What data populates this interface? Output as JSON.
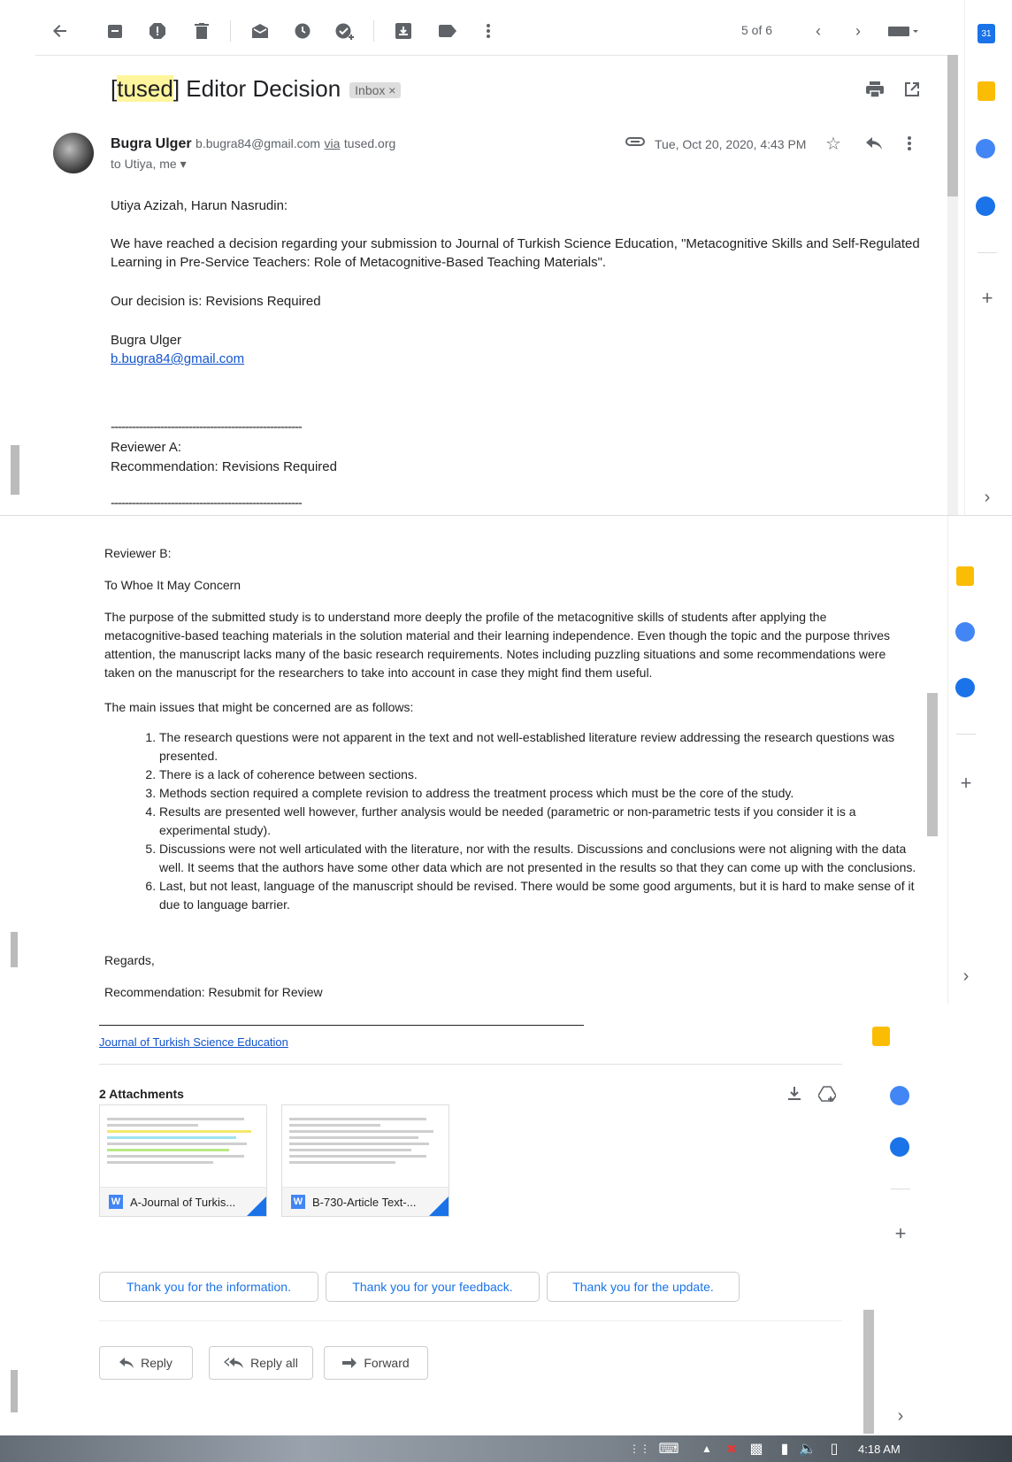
{
  "toolbar": {
    "pagination": "5 of 6"
  },
  "email": {
    "subject_tag": "tused",
    "subject_rest": "Editor Decision",
    "label": "Inbox",
    "sender_name": "Bugra Ulger",
    "sender_email": "b.bugra84@gmail.com",
    "via_text": "via",
    "via_domain": "tused.org",
    "to_line": "to Utiya, me",
    "date": "Tue, Oct 20, 2020, 4:43 PM"
  },
  "body": {
    "greeting": "Utiya Azizah, Harun Nasrudin:",
    "para1": "We have reached a decision regarding your submission to Journal of Turkish Science Education, \"Metacognitive Skills and Self-Regulated Learning in Pre-Service Teachers: Role of Metacognitive-Based Teaching Materials\".",
    "decision": "Our decision is: Revisions Required",
    "signer_name": "Bugra Ulger",
    "signer_email": "b.bugra84@gmail.com",
    "separator": "------------------------------------------------------",
    "reviewer_a": "Reviewer A:",
    "recommendation_a": "Recommendation: Revisions Required",
    "reviewer_b": "Reviewer B:",
    "concern": "To Whoe It May Concern",
    "para_purpose": "The purpose of the submitted study is to understand more deeply the profile of the metacognitive skills of students after applying the metacognitive-based teaching materials in the solution material and their learning independence. Even though the topic and the purpose thrives attention, the manuscript lacks many of the basic research requirements. Notes including puzzling situations and some recommendations were taken on the manuscript for the researchers to take into account in case they might find them useful.",
    "issues_intro": "The main issues that might be concerned are as follows:",
    "issues": [
      "The research questions were not apparent in the text and not well-established literature review addressing the research questions was presented.",
      "There is a lack of coherence between sections.",
      "Methods section required a complete revision to address the treatment process which must be the core of the study.",
      "Results are presented well however, further analysis would be needed (parametric or non-parametric tests if you consider it is a experimental study).",
      "Discussions were not well articulated with the literature, nor with the results. Discussions and conclusions were not aligning with the data well. It seems that the authors have some other data which are not presented in the results so that they can come up with the conclusions.",
      "Last, but not least, language of the manuscript should be revised. There would be some good arguments, but it is hard to make sense of it due to language barrier."
    ],
    "regards": "Regards,",
    "recommendation_b": "Recommendation: Resubmit for Review",
    "journal_link": "Journal of Turkish Science Education"
  },
  "attachments": {
    "title": "2 Attachments",
    "files": [
      {
        "name": "A-Journal of Turkis...",
        "type": "W"
      },
      {
        "name": "B-730-Article Text-...",
        "type": "W"
      }
    ]
  },
  "smart_replies": [
    "Thank you for the information.",
    "Thank you for your feedback.",
    "Thank you for the update."
  ],
  "actions": {
    "reply": "Reply",
    "reply_all": "Reply all",
    "forward": "Forward"
  },
  "taskbar": {
    "time": "4:18 AM"
  },
  "colors": {
    "accent": "#1a73e8",
    "highlight": "#fff59d",
    "link": "#1155cc"
  }
}
